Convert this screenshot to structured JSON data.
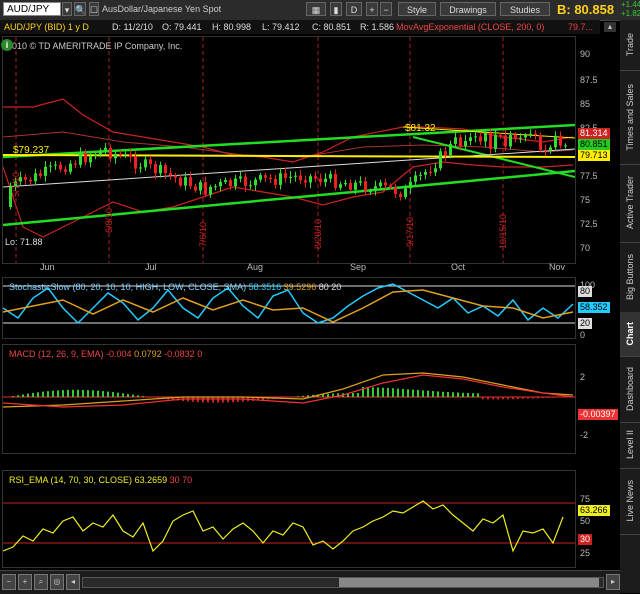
{
  "toolbar": {
    "symbol": "AUD/JPY",
    "description": "AusDollar/Japanese Yen Spot",
    "period_btn": "D",
    "style_label": "Style",
    "drawings_label": "Drawings",
    "studies_label": "Studies",
    "bid": "B: 80.858",
    "change_up": "+1.444",
    "change_pct": "+1.82%"
  },
  "infobar": {
    "symbol": "AUD/JPY (BID) 1 y D",
    "date": "D: 11/2/10",
    "open": "O: 79.441",
    "high": "H: 80.998",
    "low": "L: 79.412",
    "close": "C: 80.851",
    "range": "R: 1.586",
    "study": "MovAvgExponential (CLOSE, 200, 0)",
    "study_value": "79.7..."
  },
  "price_panel": {
    "copyright": "2010 © TD AMERITRADE IP Company, Inc.",
    "label_79237": "$79.237",
    "label_8132": "$81.32",
    "label_low": "Lo: 71.88",
    "dates": [
      "5/7/10",
      "6/8/10",
      "7/6/10",
      "8/20/10",
      "9/17/10",
      "10/15/10"
    ],
    "yticks": [
      "90",
      "87.5",
      "85",
      "82.5",
      "80",
      "77.5",
      "75",
      "72.5",
      "70"
    ],
    "tags": {
      "ma": "81.314",
      "last": "80.851",
      "yellow": "79.713"
    },
    "months": [
      "Jun",
      "Jul",
      "Aug",
      "Sep",
      "Oct",
      "Nov"
    ],
    "colors": {
      "up": "#33dd33",
      "down": "#ee2222",
      "channel": "#22dd22",
      "support": "#ffee00",
      "ma": "#cc2222"
    }
  },
  "stoch": {
    "title": "StochasticSlow (80, 20, 10, 10, HIGH, LOW, CLOSE, SMA)",
    "v1": "58.3516",
    "v2": "39.5296",
    "v3": "80",
    "v4": "20",
    "yticks": [
      "100",
      "80",
      "20",
      "0"
    ],
    "tag": "58.352"
  },
  "macd": {
    "title": "MACD (12, 26, 9, EMA)",
    "v1": "-0.004",
    "v2": "0.0792",
    "v3": "-0.0832",
    "v4": "0",
    "yticks": [
      "2",
      "-2"
    ],
    "tag": "-0.00397"
  },
  "rsi": {
    "title": "RSI_EMA (14, 70, 30, CLOSE)",
    "v1": "63.2659",
    "v2": "30",
    "v3": "70",
    "yticks": [
      "75",
      "50",
      "25"
    ],
    "tag": "63.266",
    "tag2": "30"
  },
  "side_tabs": [
    "Trade",
    "Times and Sales",
    "Active Trader",
    "Big Buttons",
    "Chart",
    "Dashboard",
    "Level II",
    "Live News"
  ]
}
